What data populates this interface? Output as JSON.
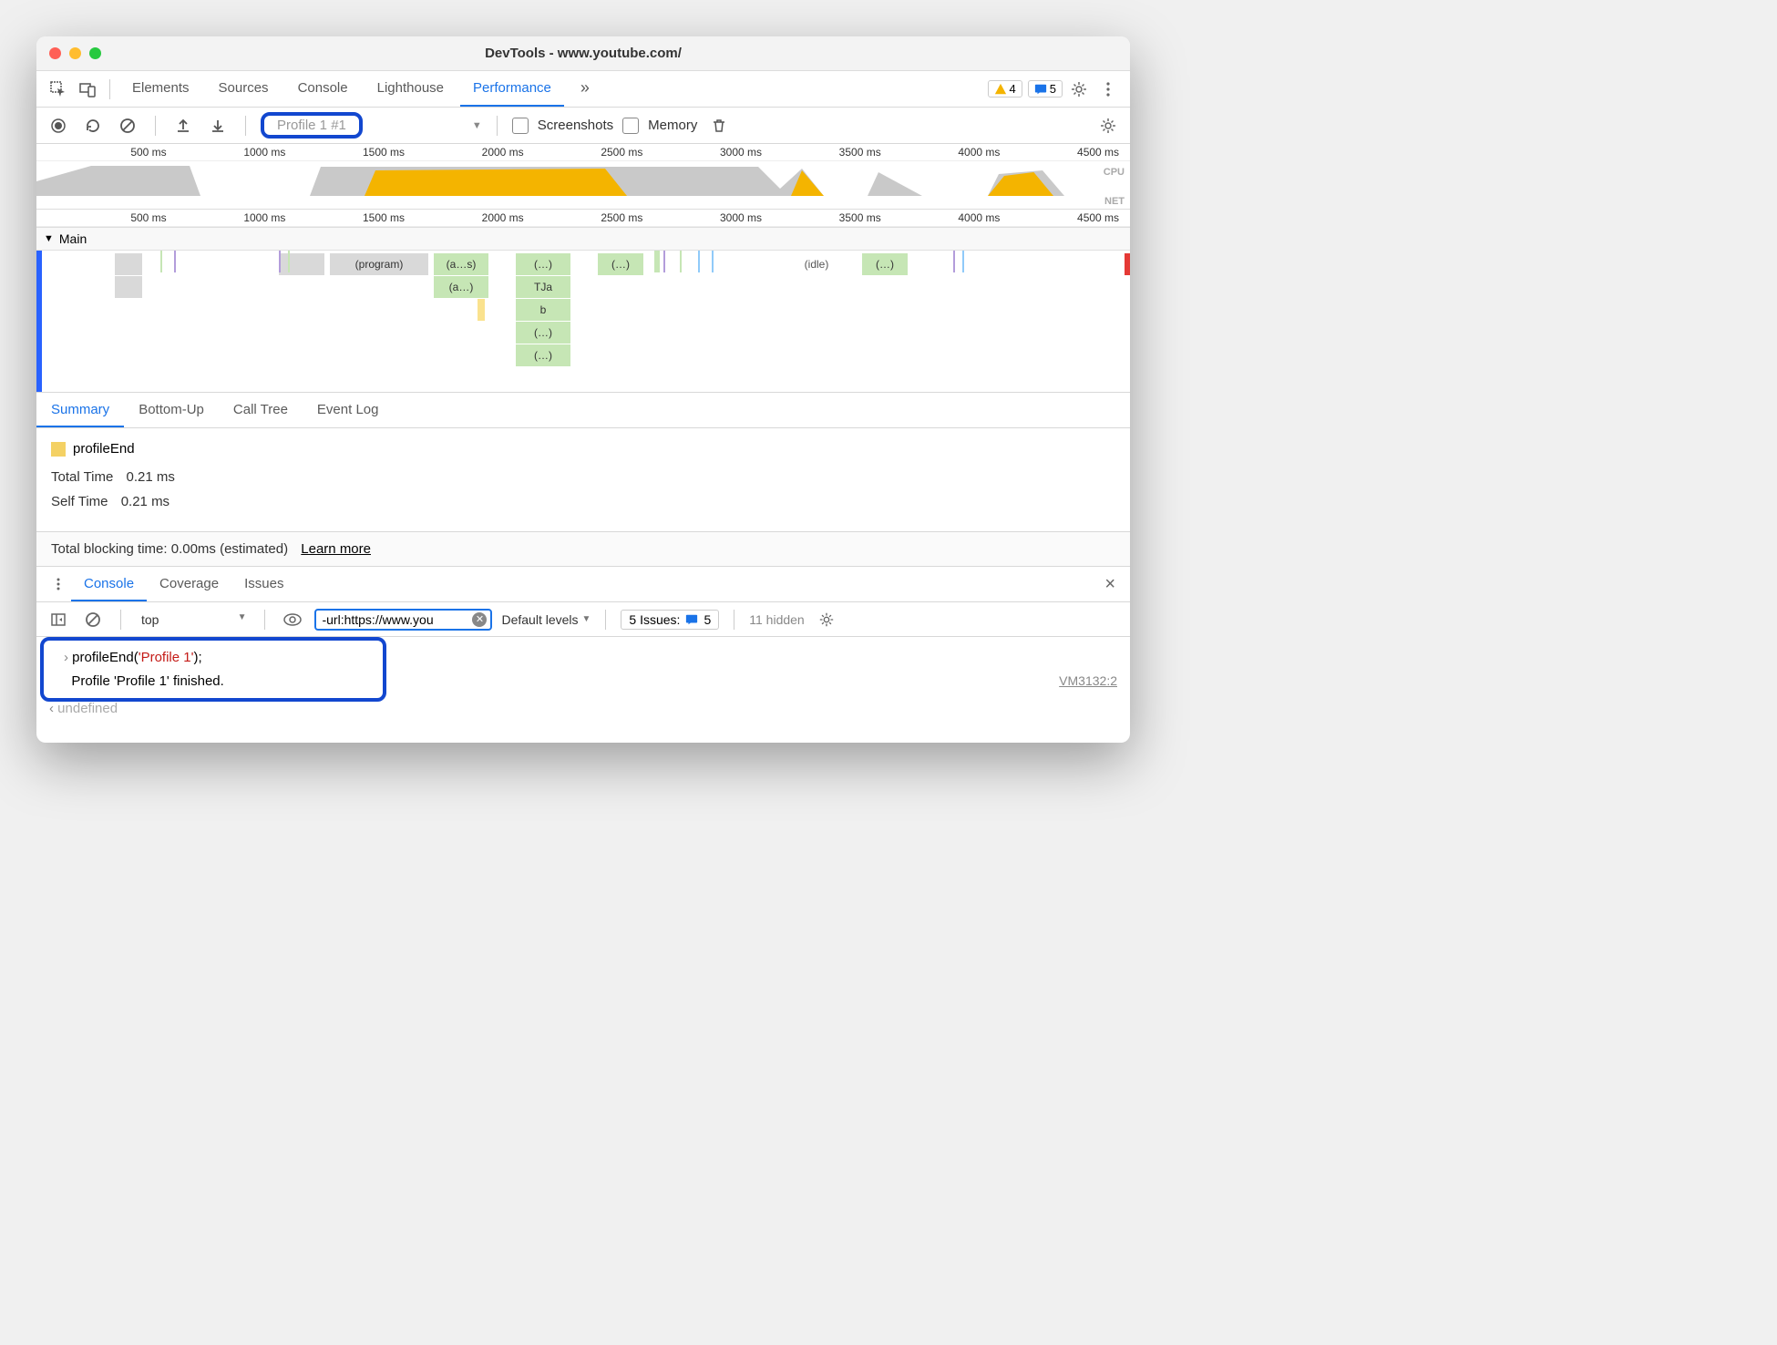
{
  "window_title": "DevTools - www.youtube.com/",
  "main_tabs": [
    "Elements",
    "Sources",
    "Console",
    "Lighthouse",
    "Performance"
  ],
  "main_tab_active": "Performance",
  "overflow_glyph": "»",
  "warnings_count": "4",
  "messages_count": "5",
  "profile_selector": "Profile 1 #1",
  "screenshots_label": "Screenshots",
  "memory_label": "Memory",
  "ruler_ticks": [
    "500 ms",
    "1000 ms",
    "1500 ms",
    "2000 ms",
    "2500 ms",
    "3000 ms",
    "3500 ms",
    "4000 ms",
    "4500 ms"
  ],
  "cpu_label": "CPU",
  "net_label": "NET",
  "main_track_label": "Main",
  "flame_labels": {
    "program": "(program)",
    "as": "(a…s)",
    "a": "(a…)",
    "ellipsis": "(…)",
    "tja": "TJa",
    "b": "b",
    "idle": "(idle)"
  },
  "subtabs": [
    "Summary",
    "Bottom-Up",
    "Call Tree",
    "Event Log"
  ],
  "subtab_active": "Summary",
  "summary": {
    "name": "profileEnd",
    "total_time_label": "Total Time",
    "total_time_value": "0.21 ms",
    "self_time_label": "Self Time",
    "self_time_value": "0.21 ms"
  },
  "blocking_text": "Total blocking time: 0.00ms (estimated)",
  "blocking_link": "Learn more",
  "drawer_tabs": [
    "Console",
    "Coverage",
    "Issues"
  ],
  "drawer_tab_active": "Console",
  "console_context": "top",
  "console_filter": "-url:https://www.you",
  "console_levels": "Default levels",
  "issues_label": "5 Issues:",
  "issues_count": "5",
  "hidden_label": "11 hidden",
  "console": {
    "line1_pre": "profileEnd(",
    "line1_str": "'Profile 1'",
    "line1_post": ");",
    "line2": "Profile 'Profile 1' finished.",
    "line3": "undefined",
    "vm": "VM3132:2"
  }
}
